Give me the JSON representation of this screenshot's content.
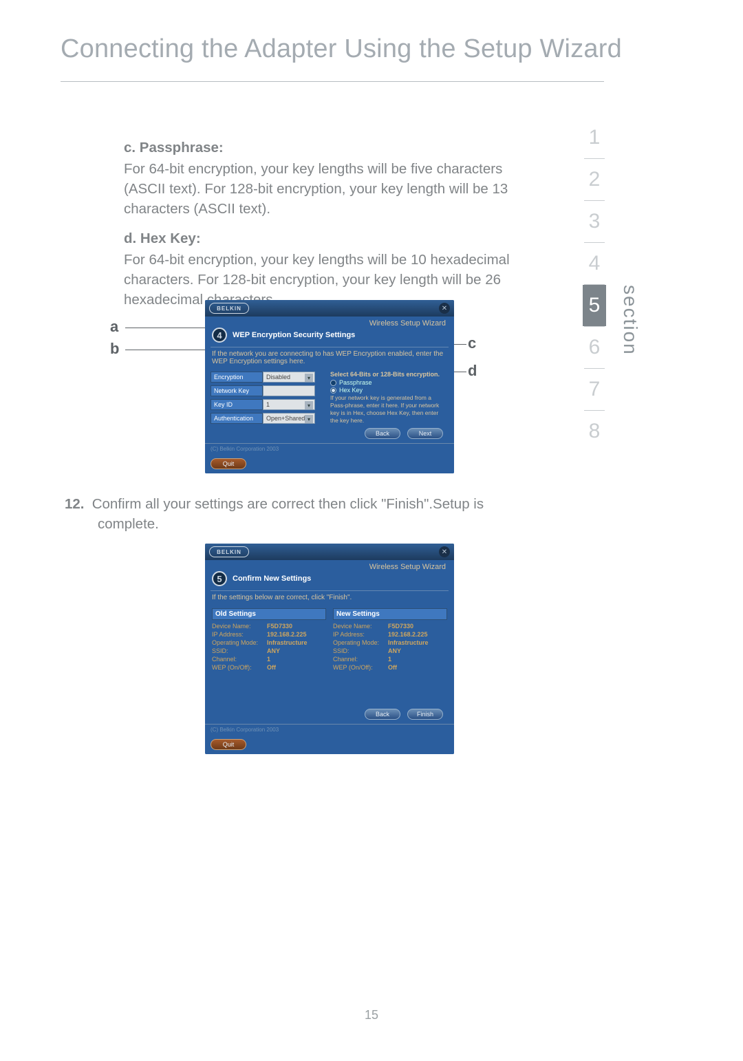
{
  "page": {
    "title": "Connecting the Adapter Using the Setup Wizard",
    "number": "15",
    "side_label": "section"
  },
  "nav": {
    "items": [
      "1",
      "2",
      "3",
      "4",
      "5",
      "6",
      "7",
      "8"
    ],
    "active_index": 4
  },
  "section_c": {
    "heading": "c. Passphrase:",
    "body": "For 64-bit encryption, your key lengths will be five characters (ASCII text). For 128-bit encryption, your key length will be 13 characters (ASCII text)."
  },
  "section_d": {
    "heading": "d. Hex Key:",
    "body": "For 64-bit encryption, your key lengths will be 10 hexadecimal characters. For 128-bit encryption, your key length will be 26 hexadecimal characters."
  },
  "callouts": {
    "a": "a",
    "b": "b",
    "c": "c",
    "d": "d"
  },
  "step12": {
    "num": "12.",
    "text_first": "Confirm all your settings are correct then click \"Finish\".Setup is",
    "text_cont": "complete."
  },
  "wizard_common": {
    "logo": "BELKIN",
    "close_glyph": "✕",
    "subtitle": "Wireless Setup Wizard",
    "copyright": "(C) Belkin Corporation 2003",
    "back": "Back",
    "next": "Next",
    "finish": "Finish",
    "quit": "Quit"
  },
  "wiz1": {
    "step_num": "4",
    "step_title": "WEP Encryption Security Settings",
    "instruction": "If the network you are connecting to has WEP Encryption enabled, enter the WEP Encryption settings here.",
    "rows": {
      "encryption": {
        "label": "Encryption",
        "value": "Disabled",
        "type": "select"
      },
      "network_key": {
        "label": "Network Key",
        "value": "",
        "type": "text"
      },
      "key_id": {
        "label": "Key ID",
        "value": "1",
        "type": "select"
      },
      "authentication": {
        "label": "Authentication",
        "value": "Open+Shared",
        "type": "select"
      }
    },
    "right": {
      "select_line": "Select 64-Bits or 128-Bits encryption.",
      "radio_passphrase": "Passphrase",
      "radio_hex": "Hex Key",
      "advice": "If your network key is generated from a Pass-phrase, enter it here. If your network key is in Hex, choose Hex Key, then enter the key here."
    }
  },
  "wiz2": {
    "step_num": "5",
    "step_title": "Confirm New Settings",
    "instruction": "If the settings below are correct, click \"Finish\".",
    "old_head": "Old Settings",
    "new_head": "New Settings",
    "labels": {
      "device": "Device Name:",
      "ip": "IP Address:",
      "mode": "Operating Mode:",
      "ssid": "SSID:",
      "channel": "Channel:",
      "wep": "WEP (On/Off):"
    },
    "old": {
      "device": "F5D7330",
      "ip": "192.168.2.225",
      "mode": "Infrastructure",
      "ssid": "ANY",
      "channel": "1",
      "wep": "Off"
    },
    "new": {
      "device": "F5D7330",
      "ip": "192.168.2.225",
      "mode": "Infrastructure",
      "ssid": "ANY",
      "channel": "1",
      "wep": "Off"
    }
  }
}
